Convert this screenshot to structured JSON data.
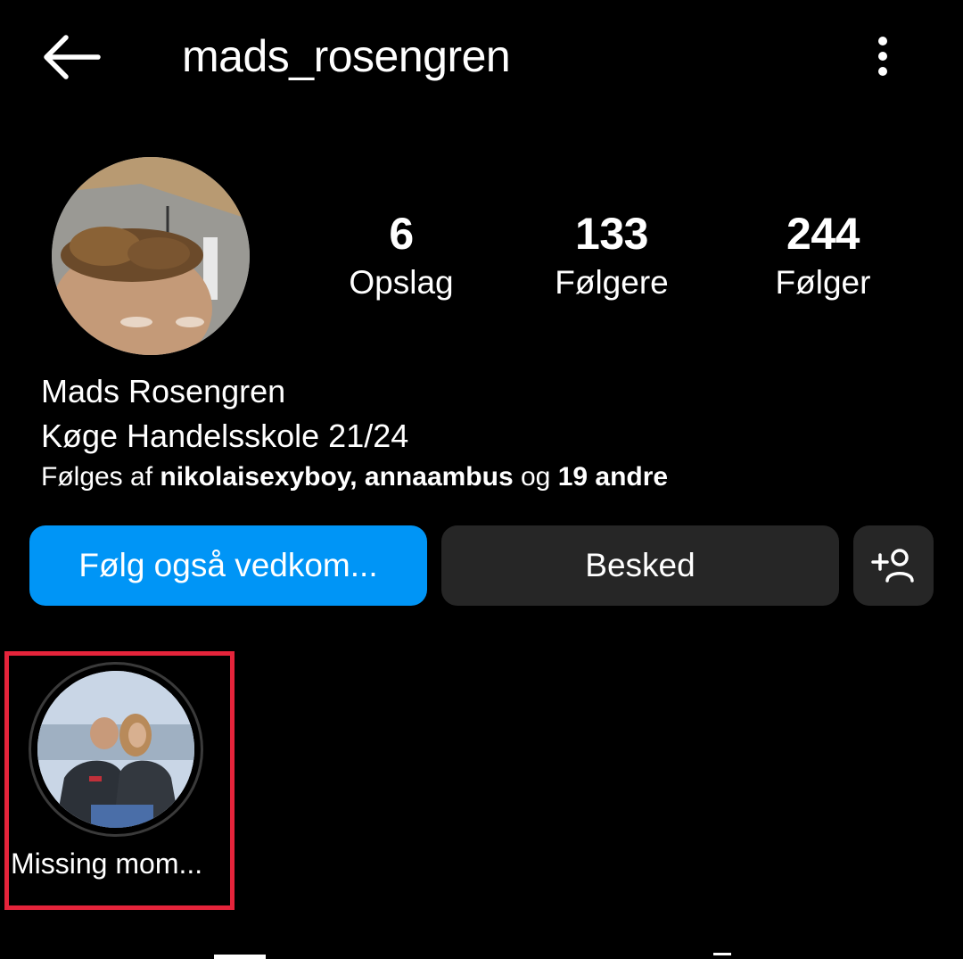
{
  "header": {
    "username": "mads_rosengren",
    "back_icon": "arrow-left-icon",
    "menu_icon": "more-vertical-icon"
  },
  "profile": {
    "avatar": "profile-photo",
    "stats": [
      {
        "value": "6",
        "label": "Opslag"
      },
      {
        "value": "133",
        "label": "Følgere"
      },
      {
        "value": "244",
        "label": "Følger"
      }
    ],
    "name": "Mads Rosengren",
    "bio": "Køge Handelsskole 21/24",
    "followed_by": {
      "prefix": "Følges af ",
      "user1": "nikolaisexyboy",
      "sep": ", ",
      "user2": "annaambus",
      "joiner": " og ",
      "others": "19 andre"
    }
  },
  "actions": {
    "follow_label": "Følg også vedkom...",
    "message_label": "Besked",
    "add_user_icon": "add-person-icon"
  },
  "highlights": [
    {
      "label": "Missing mom...",
      "image": "highlight-cover-photo"
    }
  ],
  "colors": {
    "background": "#000000",
    "primary_button": "#0095f6",
    "secondary_button": "#262626",
    "highlight_marker": "#e5243b"
  }
}
